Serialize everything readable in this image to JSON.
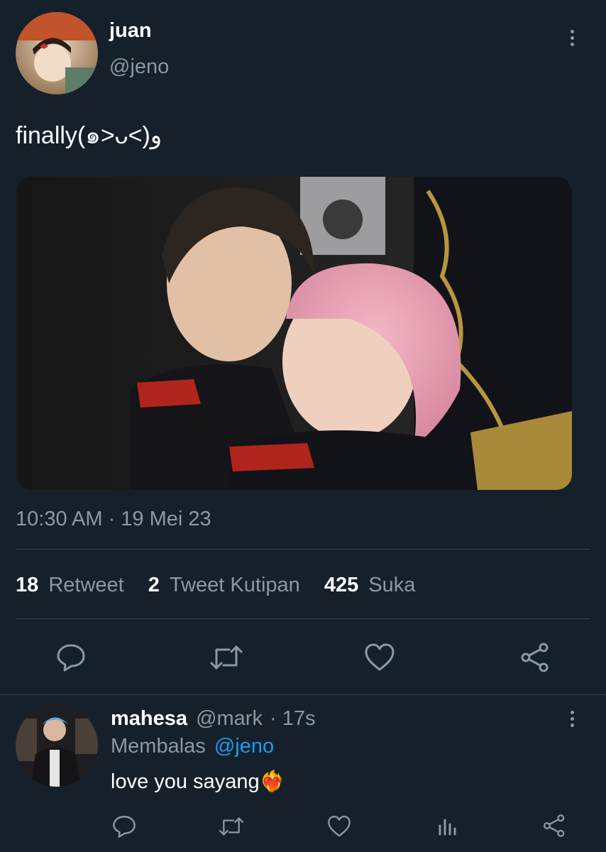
{
  "tweet": {
    "author_name": "juan",
    "author_handle": "@jeno",
    "text": "finally(๑˃ᴗ˂)ﻭ",
    "timestamp": "10:30 AM · 19 Mei 23",
    "stats": {
      "retweet_count": "18",
      "retweet_label": "Retweet",
      "quote_count": "2",
      "quote_label": "Tweet Kutipan",
      "like_count": "425",
      "like_label": "Suka"
    }
  },
  "reply": {
    "author_name": "mahesa",
    "author_handle": "@mark",
    "age": "· 17s",
    "replying_label": "Membalas",
    "replying_to": "@jeno",
    "text": "love you sayang❤️‍🔥"
  },
  "colors": {
    "background": "#15202b",
    "muted": "#8899a6",
    "link": "#1d9bf0",
    "divider": "#38444d"
  }
}
